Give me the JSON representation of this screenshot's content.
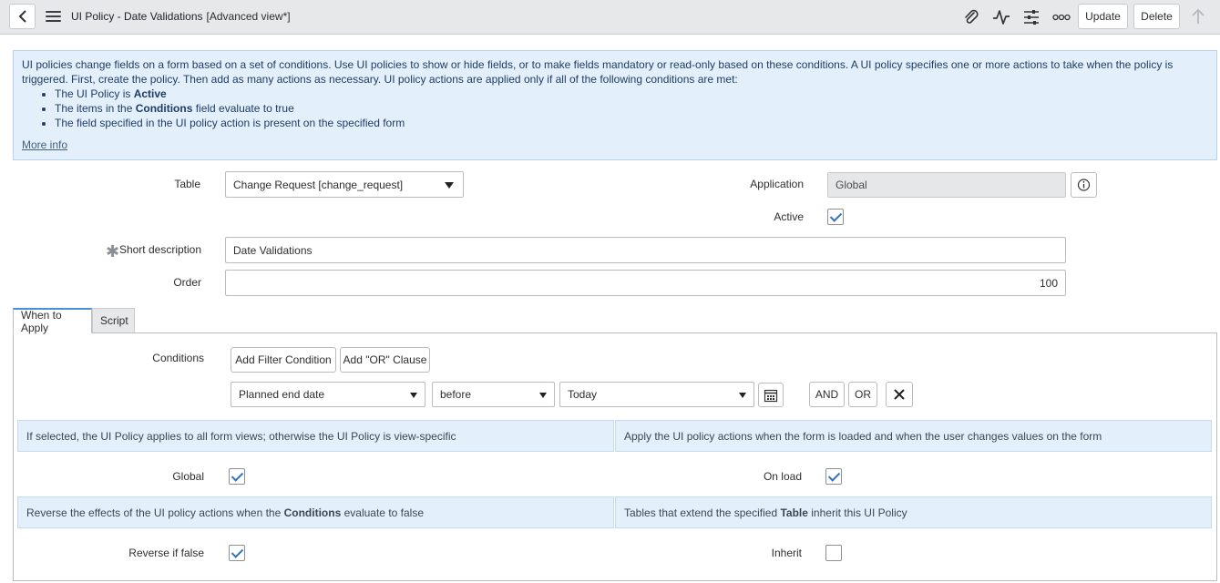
{
  "header": {
    "title": "UI Policy - Date Validations",
    "view": "[Advanced view*]",
    "update_label": "Update",
    "delete_label": "Delete"
  },
  "info": {
    "line1": "UI policies change fields on a form based on a set of conditions. Use UI policies to show or hide fields, or to make fields mandatory or read-only based on these conditions. A UI policy specifies one or more actions to take when the policy is triggered. First, create the policy. Then add as many actions as necessary. UI policy actions are applied only if all of the following conditions are met:",
    "b1_pre": "The UI Policy is ",
    "b1_bold": "Active",
    "b2_pre": "The items in the ",
    "b2_bold": "Conditions",
    "b2_post": " field evaluate to true",
    "b3": "The field specified in the UI policy action is present on the specified form",
    "more_info": "More info"
  },
  "form": {
    "table_label": "Table",
    "table_value": "Change Request [change_request]",
    "application_label": "Application",
    "application_value": "Global",
    "active_label": "Active",
    "active_checked": true,
    "short_desc_label": "Short description",
    "short_desc_value": "Date Validations",
    "order_label": "Order",
    "order_value": "100"
  },
  "tabs": [
    {
      "label": "When to Apply",
      "active": true
    },
    {
      "label": "Script",
      "active": false
    }
  ],
  "conditions": {
    "label": "Conditions",
    "add_filter": "Add Filter Condition",
    "add_or": "Add \"OR\" Clause",
    "field": "Planned end date",
    "operator": "before",
    "value": "Today",
    "and_label": "AND",
    "or_label": "OR"
  },
  "hints": {
    "global": "If selected, the UI Policy applies to all form views; otherwise the UI Policy is view-specific",
    "onload": "Apply the UI policy actions when the form is loaded and when the user changes values on the form",
    "reverse_pre": "Reverse the effects of the UI policy actions when the ",
    "reverse_bold": "Conditions",
    "reverse_post": " evaluate to false",
    "inherit_pre": "Tables that extend the specified ",
    "inherit_bold": "Table",
    "inherit_post": " inherit this UI Policy"
  },
  "options": {
    "global_label": "Global",
    "global_checked": true,
    "onload_label": "On load",
    "onload_checked": true,
    "reverse_label": "Reverse if false",
    "reverse_checked": true,
    "inherit_label": "Inherit",
    "inherit_checked": false
  }
}
